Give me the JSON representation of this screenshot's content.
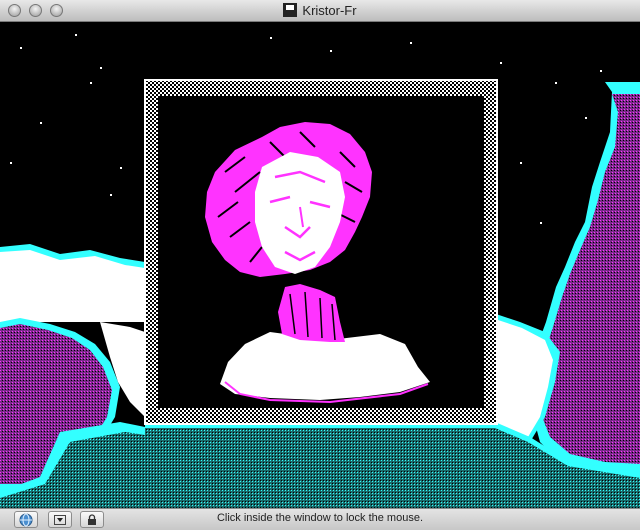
{
  "window": {
    "title": "Kristor-Fr"
  },
  "statusbar": {
    "message": "Click inside the window to lock the mouse."
  },
  "icons": {
    "close": "close-icon",
    "minimize": "minimize-icon",
    "zoom": "zoom-icon",
    "disk": "floppy-disk-icon",
    "net": "network-globe-icon",
    "menu": "menu-dropdown-icon",
    "lock": "lock-icon"
  },
  "colors": {
    "magenta": "#ff33ff",
    "cyan": "#33ffff",
    "purple": "#7a2a8a",
    "white": "#ffffff",
    "black": "#000000"
  }
}
